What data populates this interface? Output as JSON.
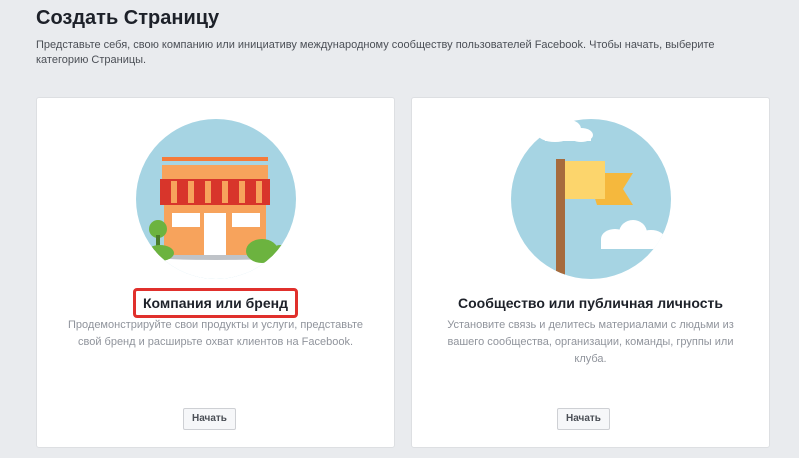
{
  "header": {
    "title": "Создать Страницу",
    "subtitle": "Представьте себя, свою компанию или инициативу международному сообществу пользователей Facebook. Чтобы начать, выберите категорию Страницы."
  },
  "cards": [
    {
      "title": "Компания или бренд",
      "description": "Продемонстрируйте свои продукты и услуги, представьте свой бренд и расширьте охват клиентов на Facebook.",
      "button_label": "Начать",
      "icon": "storefront-icon"
    },
    {
      "title": "Сообщество или публичная личность",
      "description": "Установите связь и делитесь материалами с людьми из вашего сообщества, организации, команды, группы или клуба.",
      "button_label": "Начать",
      "icon": "flag-icon"
    }
  ],
  "colors": {
    "background": "#e9ebee",
    "card": "#ffffff",
    "highlight_border": "#e0302c",
    "illustration_circle": "#a6d4e3"
  }
}
